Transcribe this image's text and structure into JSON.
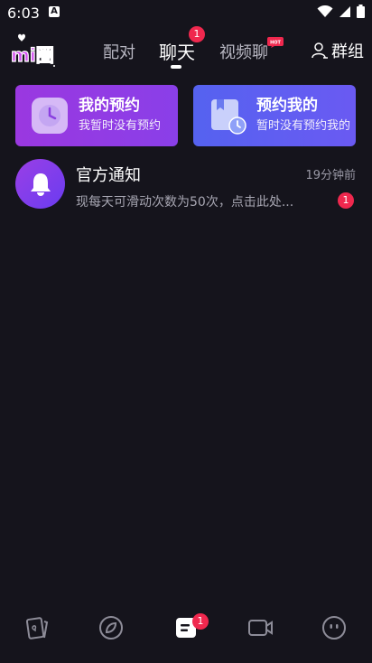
{
  "status_bar": {
    "time": "6:03",
    "notification_glyph": "A"
  },
  "header": {
    "logo_text": "mi圈",
    "tabs": [
      {
        "label": "配对",
        "active": false
      },
      {
        "label": "聊天",
        "active": true,
        "badge": "1"
      },
      {
        "label": "视频聊",
        "active": false,
        "badge": "HOT"
      }
    ],
    "group_label": "群组"
  },
  "cards": [
    {
      "title": "我的预约",
      "subtitle": "我暂时没有预约",
      "icon": "clock-icon"
    },
    {
      "title": "预约我的",
      "subtitle": "暂时没有预约我的",
      "icon": "calendar-clock-icon"
    }
  ],
  "notice": {
    "title": "官方通知",
    "time": "19分钟前",
    "message": "现每天可滑动次数为50次，点击此处...",
    "unread": "1",
    "icon": "bell-icon"
  },
  "bottom_nav": {
    "items": [
      {
        "icon": "cards-icon"
      },
      {
        "icon": "compass-icon"
      },
      {
        "icon": "chat-icon",
        "active": true,
        "badge": "1"
      },
      {
        "icon": "video-icon"
      },
      {
        "icon": "profile-icon"
      }
    ]
  },
  "colors": {
    "background": "#15141c",
    "badge": "#f0284e",
    "card_left": "#9a38e0",
    "card_right": "#5562f0"
  }
}
